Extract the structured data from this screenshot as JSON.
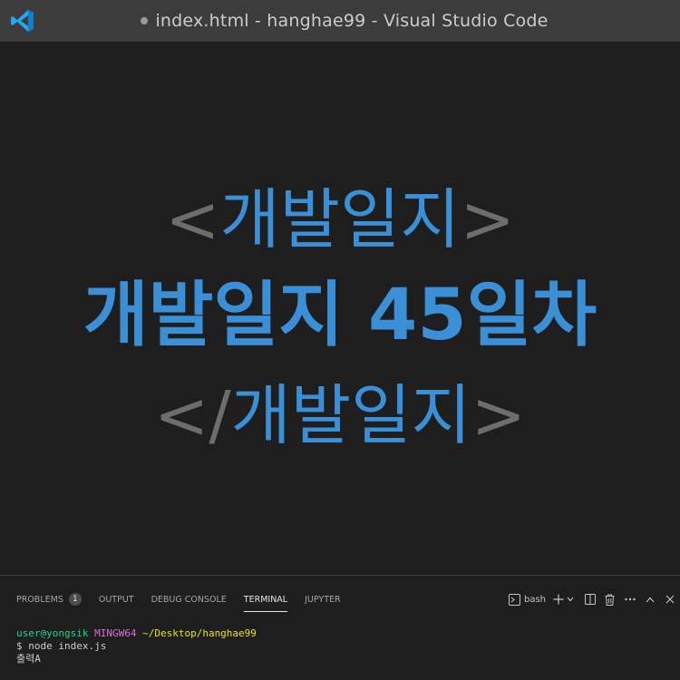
{
  "window": {
    "title": "index.html - hanghae99 - Visual Studio Code",
    "app_icon": "vscode-logo-icon",
    "dirty_indicator": "modified-dot-icon",
    "accent_color": "#3a8fd6"
  },
  "editor": {
    "open_tag_left": "<",
    "open_tag_text": "개발일지",
    "open_tag_right": ">",
    "main_line": "개발일지 45일차",
    "close_tag_left": "</",
    "close_tag_text": "개발일지",
    "close_tag_right": ">"
  },
  "panel": {
    "tabs": [
      {
        "label": "PROBLEMS",
        "badge": "1",
        "active": false
      },
      {
        "label": "OUTPUT",
        "active": false
      },
      {
        "label": "DEBUG CONSOLE",
        "active": false
      },
      {
        "label": "TERMINAL",
        "active": true
      },
      {
        "label": "JUPYTER",
        "active": false
      }
    ],
    "terminal_shell": "bash",
    "actions": [
      "terminal-icon",
      "plus-icon",
      "chevron-down-icon",
      "split-icon",
      "trash-icon",
      "more-icon",
      "chevron-up-icon",
      "close-icon"
    ]
  },
  "terminal": {
    "user": "user@yongsik",
    "host": "MINGW64",
    "path": "~/Desktop/hanghae99",
    "command": "$ node index.js",
    "output": "출력A"
  }
}
